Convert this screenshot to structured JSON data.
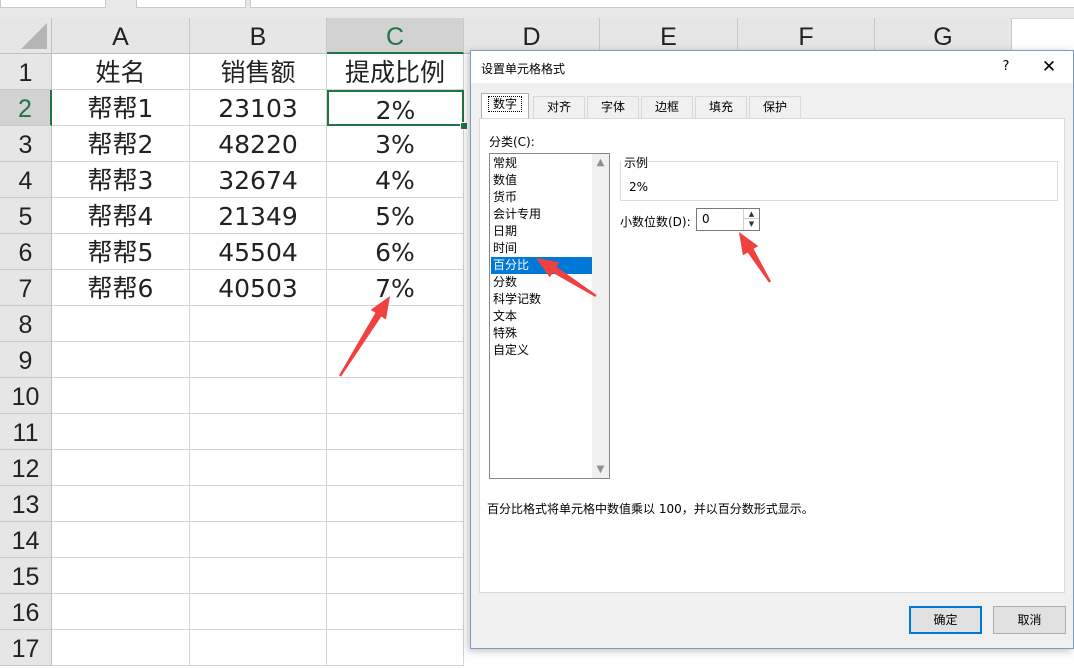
{
  "sheet": {
    "columns": [
      "A",
      "B",
      "C",
      "D",
      "E",
      "F",
      "G"
    ],
    "rows": [
      "1",
      "2",
      "3",
      "4",
      "5",
      "6",
      "7",
      "8",
      "9",
      "10",
      "11",
      "12",
      "13",
      "14",
      "15",
      "16",
      "17"
    ],
    "cells": [
      [
        "姓名",
        "销售额",
        "提成比例"
      ],
      [
        "帮帮1",
        "23103",
        "2%"
      ],
      [
        "帮帮2",
        "48220",
        "3%"
      ],
      [
        "帮帮3",
        "32674",
        "4%"
      ],
      [
        "帮帮4",
        "21349",
        "5%"
      ],
      [
        "帮帮5",
        "45504",
        "6%"
      ],
      [
        "帮帮6",
        "40503",
        "7%"
      ]
    ],
    "selected_column": "C",
    "selected_row": "2",
    "accent_color": "#217346"
  },
  "dialog": {
    "title": "设置单元格格式",
    "help": "?",
    "close": "✕",
    "tabs": [
      "数字",
      "对齐",
      "字体",
      "边框",
      "填充",
      "保护"
    ],
    "active_tab": "数字",
    "category_label": "分类(C):",
    "categories": [
      "常规",
      "数值",
      "货币",
      "会计专用",
      "日期",
      "时间",
      "百分比",
      "分数",
      "科学记数",
      "文本",
      "特殊",
      "自定义"
    ],
    "selected_category": "百分比",
    "sample_label": "示例",
    "sample_value": "2%",
    "decimal_label": "小数位数(D):",
    "decimal_value": "0",
    "description": "百分比格式将单元格中数值乘以 100，并以百分数形式显示。",
    "ok_label": "确定",
    "cancel_label": "取消",
    "selection_color": "#0078d7"
  },
  "annotations": {
    "arrow_color": "#f04040"
  }
}
